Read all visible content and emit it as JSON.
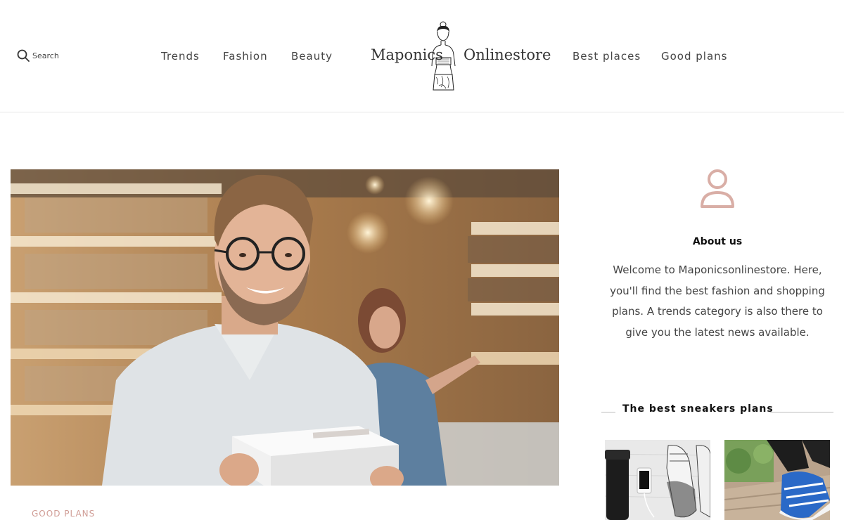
{
  "header": {
    "search_label": "Search",
    "nav_left": [
      "Trends",
      "Fashion",
      "Beauty"
    ],
    "nav_right": [
      "Best places",
      "Good plans"
    ],
    "logo": {
      "left": "Maponics",
      "right": "Onlinestore"
    }
  },
  "article": {
    "category": "GOOD PLANS"
  },
  "sidebar": {
    "about_title": "About us",
    "about_text": "Welcome to Maponicsonlinestore. Here, you'll find the best fashion and shopping plans. A trends category is also there to give you the latest news available.",
    "sneakers_title": "The best sneakers plans"
  },
  "colors": {
    "accent": "#d09d96",
    "text": "#444444",
    "divider": "#e6e6e6"
  },
  "icons": [
    "search-icon",
    "user-icon"
  ]
}
